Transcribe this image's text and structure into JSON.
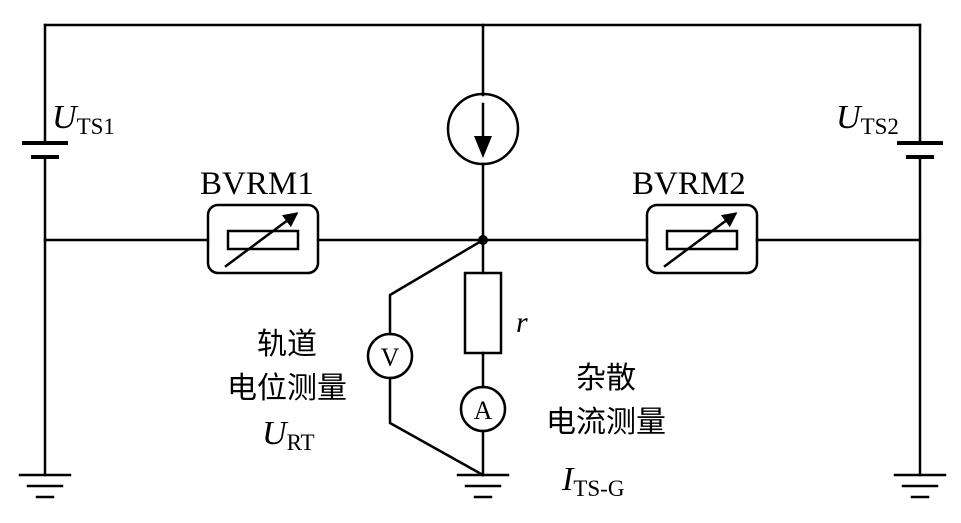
{
  "labels": {
    "uts1_main": "U",
    "uts1_sub": "TS1",
    "uts2_main": "U",
    "uts2_sub": "TS2",
    "bvrm1": "BVRM1",
    "bvrm2": "BVRM2",
    "resistor_r": "r",
    "voltmeter": "V",
    "ammeter": "A",
    "rail_potential_line1": "轨道",
    "rail_potential_line2": "电位测量",
    "urt_main": "U",
    "urt_sub": "RT",
    "stray_current_line1": "杂散",
    "stray_current_line2": "电流测量",
    "its_main": "I",
    "its_sub": "TS-G"
  },
  "icons": {
    "current_source": "current-source-icon",
    "ground": "ground-icon",
    "variable_resistor": "variable-resistor-icon",
    "battery": "battery-icon"
  }
}
